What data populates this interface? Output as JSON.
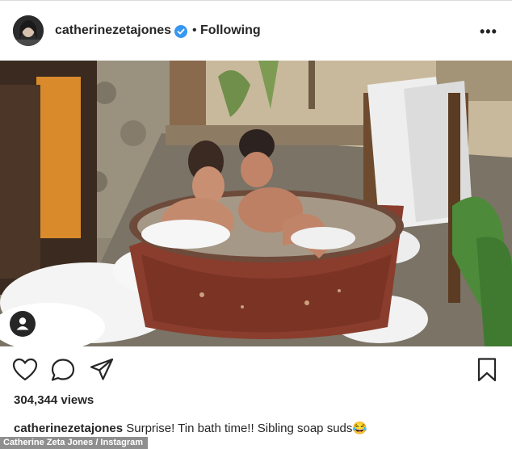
{
  "header": {
    "username": "catherinezetajones",
    "separator": "•",
    "follow_status": "Following",
    "more_label": "•••",
    "verified_color": "#3897f0"
  },
  "media": {
    "kind": "video",
    "user_tag_icon": "user-tag-icon"
  },
  "actions": {
    "like_icon": "heart-icon",
    "comment_icon": "comment-icon",
    "share_icon": "share-icon",
    "save_icon": "bookmark-icon"
  },
  "stats": {
    "views": "304,344 views"
  },
  "caption": {
    "username": "catherinezetajones",
    "text": " Surprise! Tin bath time!! Sibling soap suds😂"
  },
  "credit": "Catherine Zeta Jones / Instagram"
}
